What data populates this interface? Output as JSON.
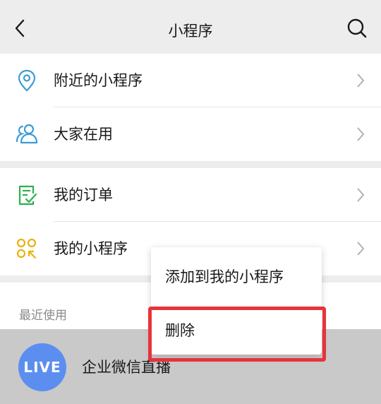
{
  "header": {
    "title": "小程序"
  },
  "menu_groups": [
    [
      {
        "label": "附近的小程序",
        "icon": "location-pin-icon"
      },
      {
        "label": "大家在用",
        "icon": "users-icon"
      }
    ],
    [
      {
        "label": "我的订单",
        "icon": "order-check-icon"
      },
      {
        "label": "我的小程序",
        "icon": "mini-program-icon"
      }
    ]
  ],
  "recent": {
    "title": "最近使用",
    "items": [
      {
        "name": "企业微信直播",
        "avatar_text": "LIVE"
      }
    ]
  },
  "context_menu": {
    "items": [
      {
        "label": "添加到我的小程序"
      },
      {
        "label": "删除"
      }
    ]
  },
  "colors": {
    "accent_blue": "#3b9cd6",
    "accent_green": "#2bb04c",
    "accent_yellow": "#e8b20e",
    "highlight_red": "#e8333a",
    "avatar_blue": "#5c8ef0"
  }
}
